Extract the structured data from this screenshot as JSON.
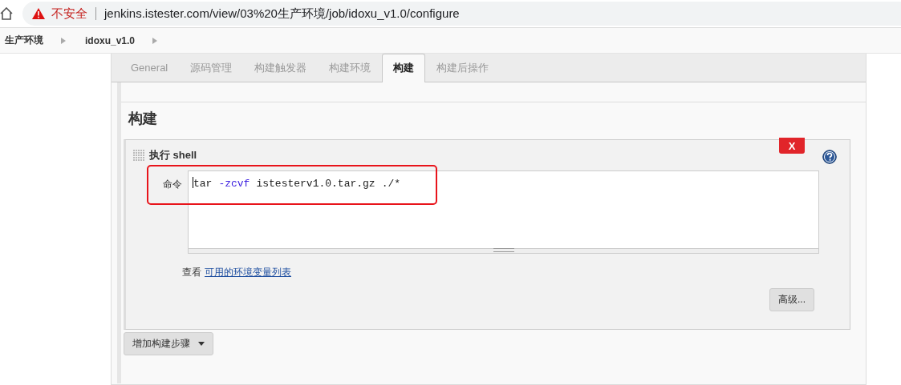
{
  "address_bar": {
    "security_label": "不安全",
    "url": "jenkins.istester.com/view/03%20生产环境/job/idoxu_v1.0/configure"
  },
  "breadcrumbs": [
    {
      "label": "生产环境"
    },
    {
      "label": "idoxu_v1.0"
    }
  ],
  "tabs": [
    {
      "label": "General",
      "selected": false
    },
    {
      "label": "源码管理",
      "selected": false
    },
    {
      "label": "构建触发器",
      "selected": false
    },
    {
      "label": "构建环境",
      "selected": false
    },
    {
      "label": "构建",
      "selected": true
    },
    {
      "label": "构建后操作",
      "selected": false
    }
  ],
  "section_title": "构建",
  "build_step": {
    "title": "执行 shell",
    "delete_label": "X",
    "field_label": "命令",
    "command": [
      {
        "kind": "word",
        "text": "tar"
      },
      {
        "kind": "option",
        "text": "-zcvf"
      },
      {
        "kind": "word",
        "text": "istesterv1.0.tar.gz"
      },
      {
        "kind": "word",
        "text": "./*"
      }
    ],
    "highlighted": true,
    "hint_text": "查看",
    "hint_link": "可用的环境变量列表",
    "advanced_button": "高级..."
  },
  "add_step_button": "增加构建步骤"
}
